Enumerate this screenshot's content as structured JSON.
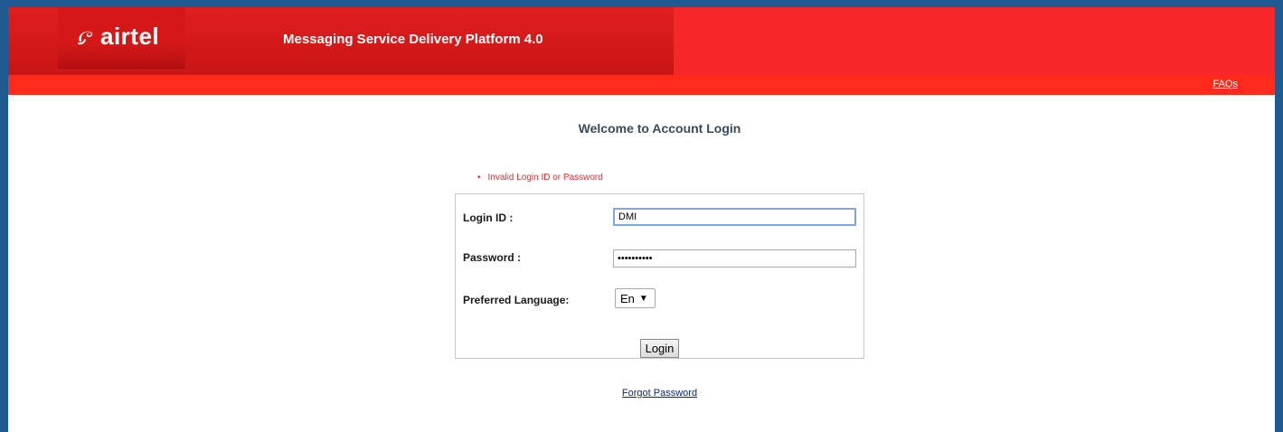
{
  "header": {
    "logo_text": "airtel",
    "platform_title": "Messaging Service Delivery Platform 4.0"
  },
  "subbar": {
    "faq_label": "FAQs"
  },
  "main": {
    "welcome": "Welcome to Account Login",
    "error_message": "Invalid Login ID or Password",
    "forgot_label": "Forgot Password"
  },
  "form": {
    "login_id_label": "Login ID :",
    "login_id_value": "DMI",
    "password_label": "Password :",
    "password_value": "••••••••••",
    "language_label": "Preferred Language:",
    "language_selected": "En",
    "login_button": "Login"
  },
  "colors": {
    "frame": "#1f5a91",
    "header_red": "#f52727",
    "error_red": "#e03030",
    "link_blue": "#0d2a6b"
  }
}
